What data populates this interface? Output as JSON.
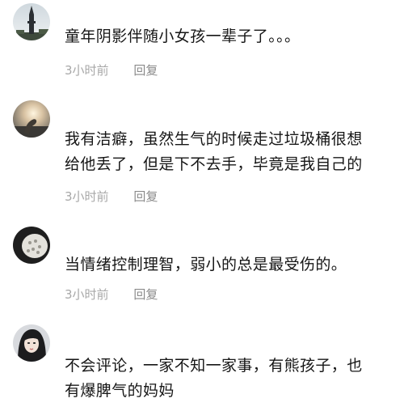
{
  "comments": [
    {
      "text_lines": [
        "童年阴影伴随小女孩一辈子了。。。"
      ],
      "time": "3小时前",
      "reply_label": "回复",
      "avatar": "tower-avatar-icon"
    },
    {
      "text_lines": [
        "我有洁癖，虽然生气的时候走过垃圾桶很想",
        "给他丢了，但是下不去手，毕竟是我自己的"
      ],
      "time": "3小时前",
      "reply_label": "回复",
      "avatar": "sunset-hand-avatar-icon"
    },
    {
      "text_lines": [
        "当情绪控制理智，弱小的总是最受伤的。"
      ],
      "time": "3小时前",
      "reply_label": "回复",
      "avatar": "round-object-avatar-icon"
    },
    {
      "text_lines": [
        "不会评论，一家不知一家事，有熊孩子，也",
        "有爆脾气的妈妈"
      ],
      "avatar": "woman-portrait-avatar-icon"
    }
  ]
}
